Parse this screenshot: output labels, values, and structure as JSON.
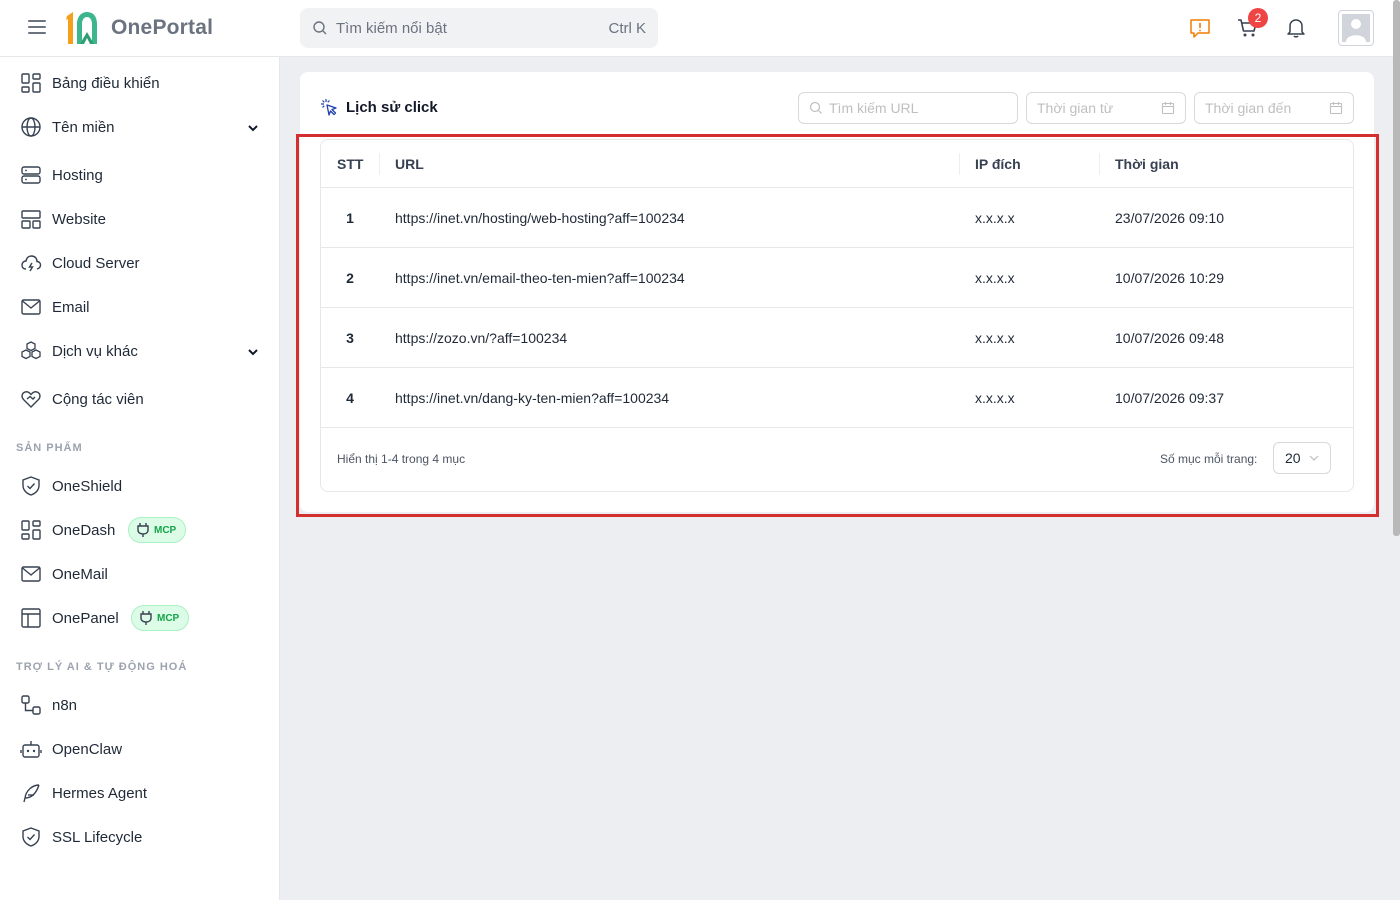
{
  "header": {
    "logo_text": "OnePortal",
    "search_placeholder": "Tìm kiếm nổi bật",
    "search_shortcut": "Ctrl K",
    "cart_badge": "2",
    "accent_color": "#ef7d00"
  },
  "sidebar": {
    "items": [
      {
        "label": "Bảng điều khiển",
        "icon": "dashboard-icon"
      },
      {
        "label": "Tên miền",
        "icon": "globe-icon"
      },
      {
        "label": "Hosting",
        "icon": "server-icon"
      },
      {
        "label": "Website",
        "icon": "layout-icon"
      },
      {
        "label": "Cloud Server",
        "icon": "cloud-icon"
      },
      {
        "label": "Email",
        "icon": "mail-icon"
      },
      {
        "label": "Dịch vụ khác",
        "icon": "boxes-icon"
      },
      {
        "label": "Cộng tác viên",
        "icon": "handshake-heart-icon"
      }
    ],
    "section_products": "SẢN PHẨM",
    "products": [
      {
        "label": "OneShield",
        "icon": "shield-icon"
      },
      {
        "label": "OneDash",
        "icon": "dashboard-icon",
        "badge": "MCP"
      },
      {
        "label": "OneMail",
        "icon": "mail-icon"
      },
      {
        "label": "OnePanel",
        "icon": "panel-icon",
        "badge": "MCP"
      }
    ],
    "section_ai": "TRỢ LÝ AI & TỰ ĐỘNG HOÁ",
    "ai": [
      {
        "label": "n8n",
        "icon": "workflow-icon"
      },
      {
        "label": "OpenClaw",
        "icon": "robot-icon"
      },
      {
        "label": "Hermes Agent",
        "icon": "feather-icon"
      },
      {
        "label": "SSL Lifecycle",
        "icon": "shield-check-icon"
      }
    ]
  },
  "main": {
    "title": "Lịch sử click",
    "url_search_placeholder": "Tìm kiếm URL",
    "date_from_placeholder": "Thời gian từ",
    "date_to_placeholder": "Thời gian đến",
    "table": {
      "columns": [
        "STT",
        "URL",
        "IP đích",
        "Thời gian"
      ],
      "rows": [
        {
          "stt": "1",
          "url": "https://inet.vn/hosting/web-hosting?aff=100234",
          "ip": "x.x.x.x",
          "time": "23/07/2026 09:10"
        },
        {
          "stt": "2",
          "url": "https://inet.vn/email-theo-ten-mien?aff=100234",
          "ip": "x.x.x.x",
          "time": "10/07/2026 10:29"
        },
        {
          "stt": "3",
          "url": "https://zozo.vn/?aff=100234",
          "ip": "x.x.x.x",
          "time": "10/07/2026 09:48"
        },
        {
          "stt": "4",
          "url": "https://inet.vn/dang-ky-ten-mien?aff=100234",
          "ip": "x.x.x.x",
          "time": "10/07/2026 09:37"
        }
      ]
    },
    "footer_summary": "Hiển thị 1-4 trong 4 mục",
    "per_page_label": "Số mục mỗi trang:",
    "per_page_value": "20"
  }
}
